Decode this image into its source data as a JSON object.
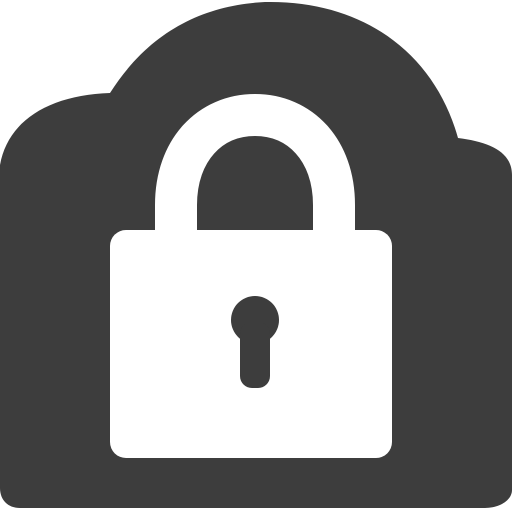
{
  "icon": {
    "name": "cloud-lock-icon",
    "colors": {
      "cloud": "#3d3d3d",
      "lock": "#ffffff",
      "background": "#ffffff"
    }
  }
}
